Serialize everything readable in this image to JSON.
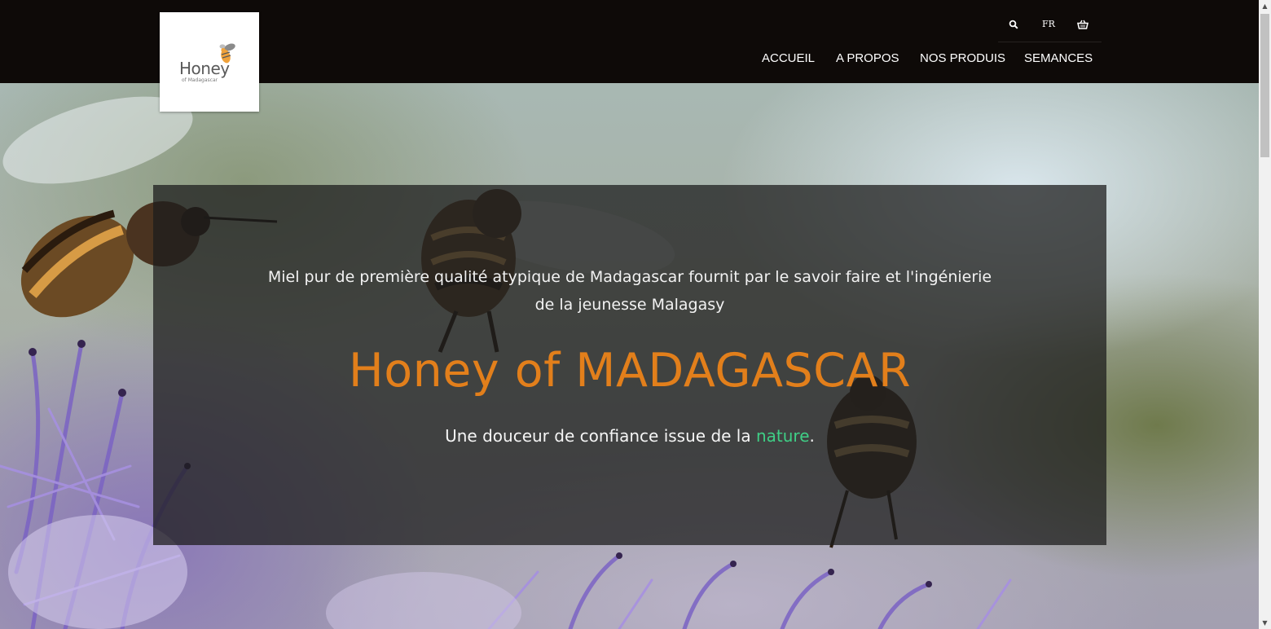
{
  "brand": {
    "logo_word": "Honey",
    "logo_sub": "of Madagascar"
  },
  "utility": {
    "search_icon": "search-icon",
    "language": "FR",
    "cart_icon": "basket-icon"
  },
  "nav": {
    "items": [
      {
        "label": "ACCUEIL"
      },
      {
        "label": "A PROPOS"
      },
      {
        "label": "NOS PRODUIS"
      },
      {
        "label": "SEMANCES"
      }
    ]
  },
  "hero": {
    "intro_line1": "Miel pur de première qualité atypique de Madagascar fournit par le savoir faire et l'ingénierie",
    "intro_line2": "de la jeunesse Malagasy",
    "headline": "Honey of MADAGASCAR",
    "tagline_before": "Une douceur de confiance issue de la ",
    "tagline_highlight": "nature",
    "tagline_after": "."
  },
  "colors": {
    "topbar": "#0e0a08",
    "accent_orange": "#e27f1b",
    "accent_green": "#3fcf86",
    "overlay": "rgba(28,28,28,0.74)"
  }
}
